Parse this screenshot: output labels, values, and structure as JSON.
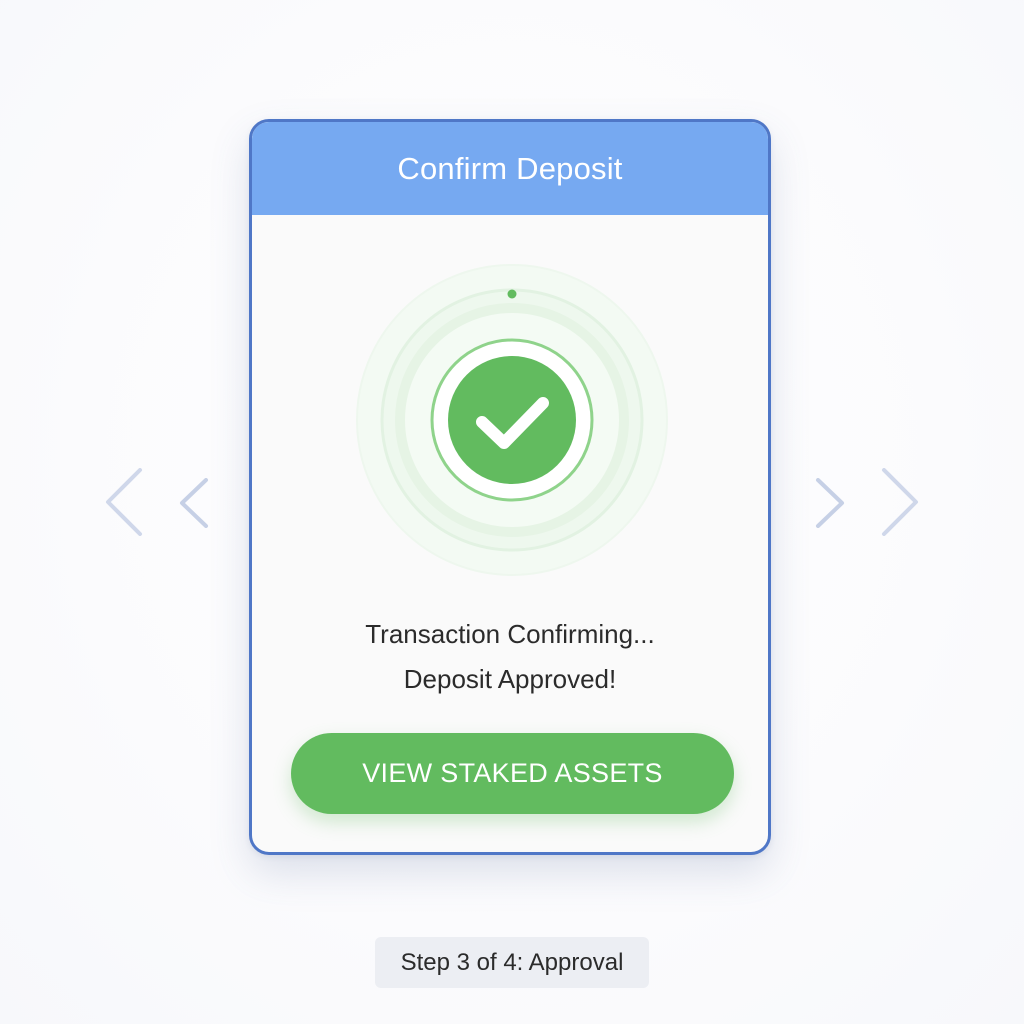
{
  "modal": {
    "title": "Confirm Deposit",
    "status_line_1": "Transaction Confirming...",
    "status_line_2": "Deposit Approved!",
    "primary_button_label": "VIEW STAKED ASSETS",
    "status_icon": "check-circle-icon"
  },
  "carousel": {
    "prev_icon": "chevron-left-icon",
    "next_icon": "chevron-right-icon"
  },
  "step_indicator": {
    "label": "Step 3 of 4: Approval"
  },
  "colors": {
    "header": "#76a9f1",
    "border": "#4f77c7",
    "success": "#62bb5f",
    "arrow": "#c9d3e8"
  }
}
